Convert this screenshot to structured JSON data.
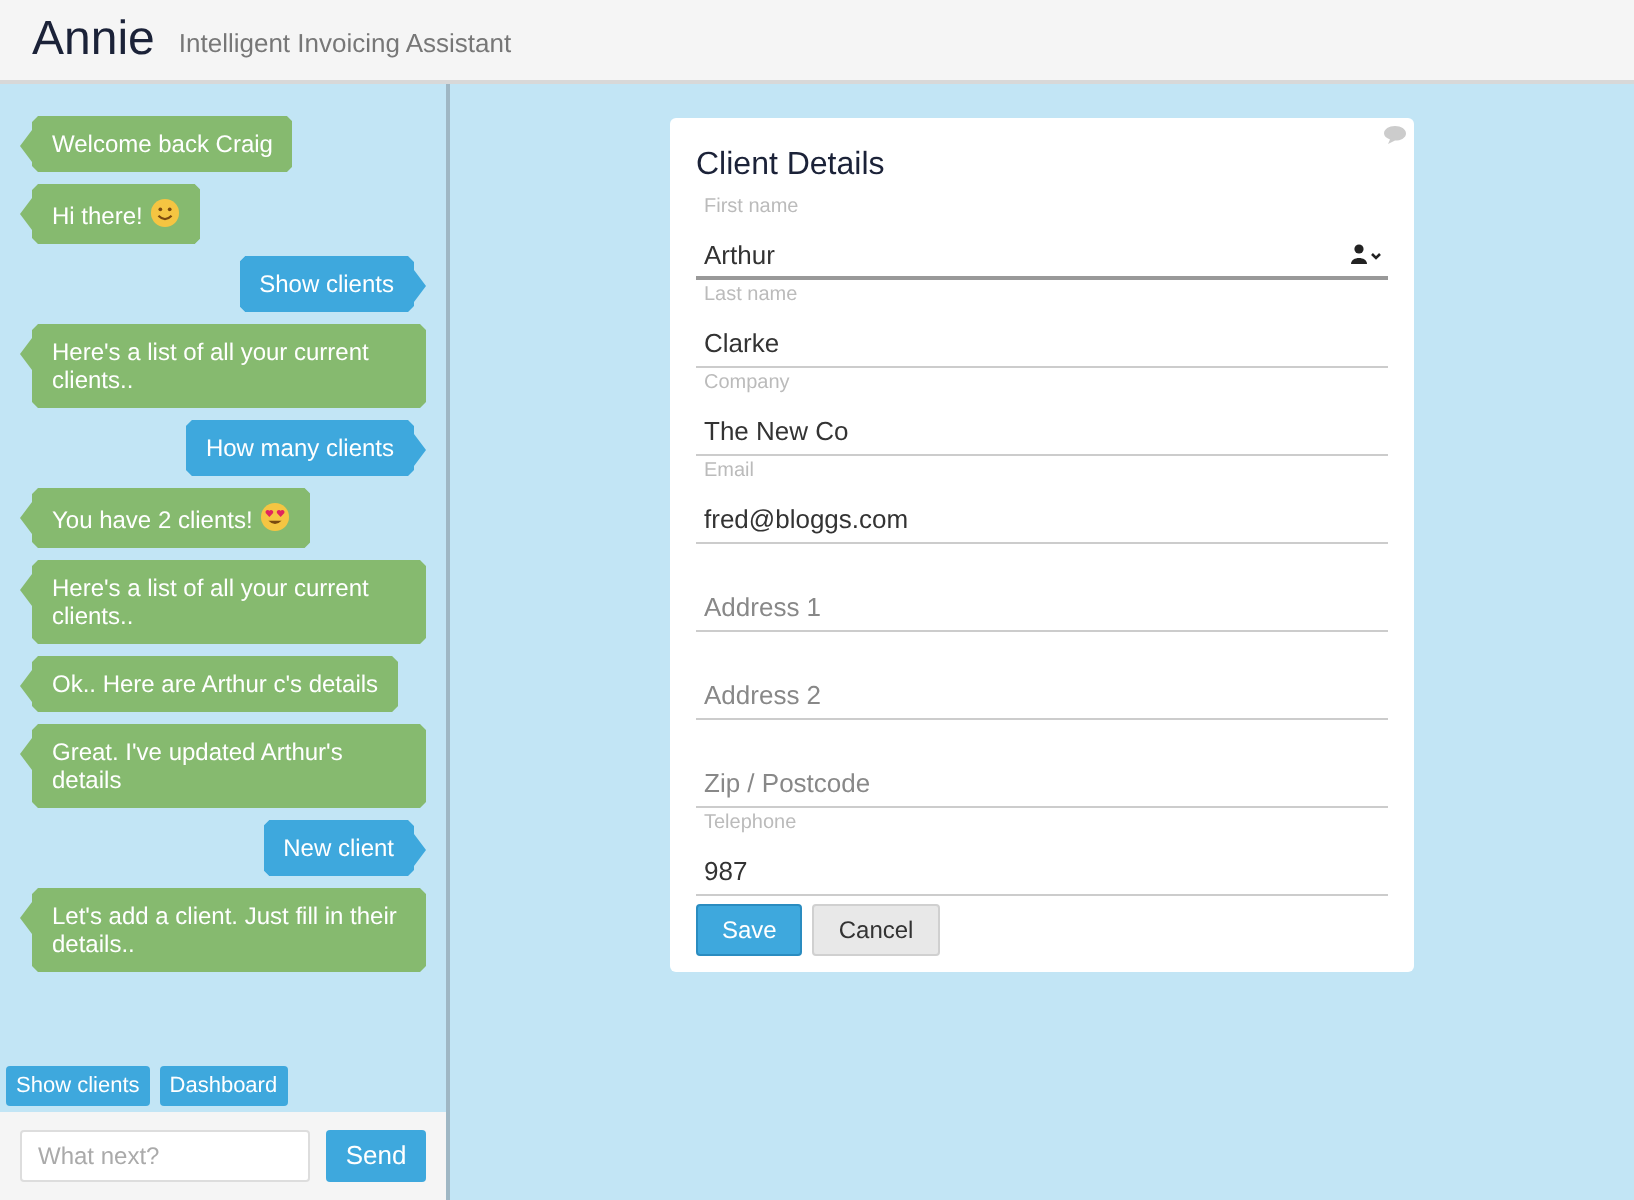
{
  "header": {
    "title": "Annie",
    "subtitle": "Intelligent Invoicing Assistant"
  },
  "messages": [
    {
      "kind": "bot",
      "text": "Welcome back Craig"
    },
    {
      "kind": "bot",
      "text": "Hi there!",
      "emoji": {
        "kind": "smile"
      }
    },
    {
      "kind": "user",
      "text": "Show clients"
    },
    {
      "kind": "bot",
      "text": "Here's a list of all your current clients.."
    },
    {
      "kind": "user",
      "text": "How many clients"
    },
    {
      "kind": "bot",
      "text": "You have 2 clients!",
      "emoji": {
        "kind": "heart_eyes"
      }
    },
    {
      "kind": "bot",
      "text": "Here's a list of all your current clients.."
    },
    {
      "kind": "bot",
      "text": "Ok.. Here are Arthur c's details"
    },
    {
      "kind": "bot",
      "text": "Great. I've updated Arthur's details"
    },
    {
      "kind": "user",
      "text": "New client"
    },
    {
      "kind": "bot",
      "text": "Let's add a client. Just fill in their details.."
    }
  ],
  "quick_replies": [
    "Show clients",
    "Dashboard"
  ],
  "chat_input": {
    "placeholder": "What next?",
    "button": "Send"
  },
  "form": {
    "title": "Client Details",
    "fields": [
      {
        "label": "First name",
        "value": "Arthur",
        "focused": true,
        "contact_picker": true
      },
      {
        "label": "Last name",
        "value": "Clarke",
        "focused": false
      },
      {
        "label": "Company",
        "value": "The New Co",
        "focused": false
      },
      {
        "label": "Email",
        "value": "fred@bloggs.com",
        "focused": false
      },
      {
        "placeholder": "Address 1",
        "focused": false
      },
      {
        "placeholder": "Address 2",
        "focused": false
      },
      {
        "placeholder": "Zip / Postcode",
        "focused": false
      },
      {
        "label": "Telephone",
        "value": "987",
        "focused": false
      }
    ],
    "buttons": [
      {
        "label": "Save",
        "kind": "primary"
      },
      {
        "label": "Cancel",
        "kind": "secondary"
      }
    ]
  }
}
